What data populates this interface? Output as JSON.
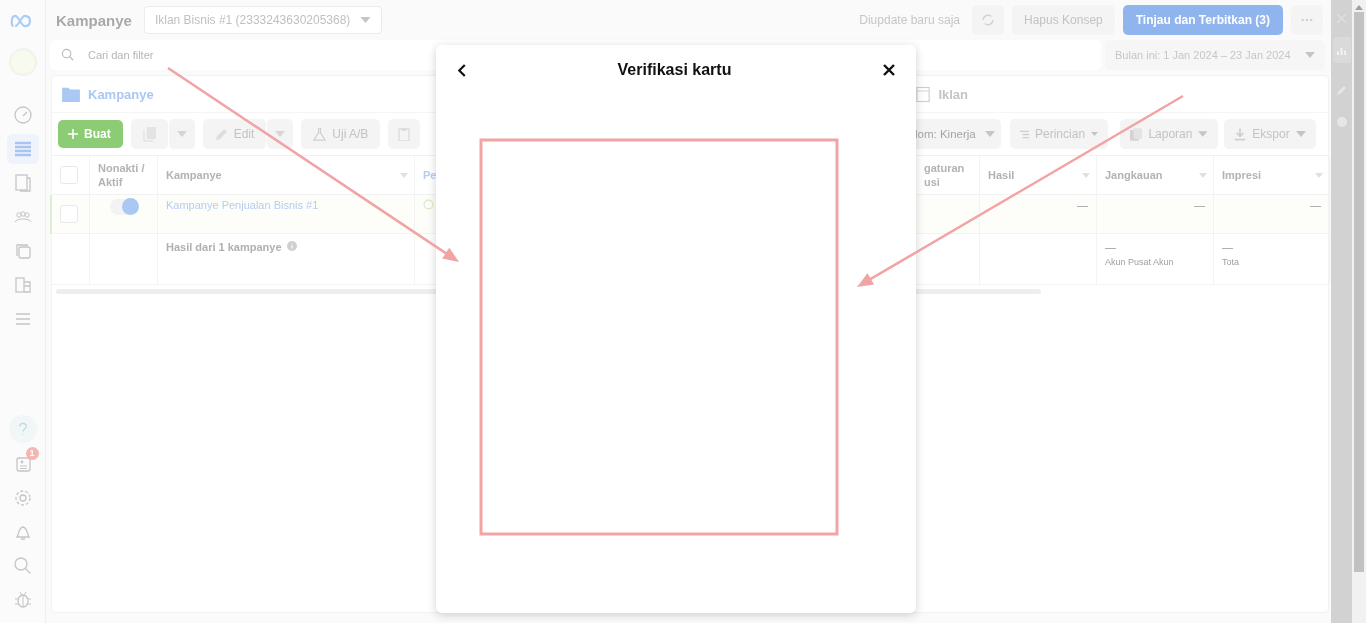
{
  "sidebar": {
    "nav_items": [
      {
        "selected": false
      },
      {
        "selected": true
      },
      {
        "selected": false
      },
      {
        "selected": false
      },
      {
        "selected": false
      },
      {
        "selected": false
      },
      {
        "selected": false
      }
    ],
    "badge": "1"
  },
  "header": {
    "title": "Kampanye",
    "account_select": "Iklan Bisnis #1 (2333243630205368)",
    "status": "Diupdate baru saja",
    "discard_button": "Hapus Konsep",
    "publish_button": "Tinjau dan Terbitkan (3)"
  },
  "search": {
    "placeholder": "Cari dan filter"
  },
  "date_range": "Bulan ini: 1 Jan 2024 – 23 Jan 2024",
  "tabs": [
    {
      "label": "Kampanye",
      "selected": true
    },
    {
      "label": "Iklan",
      "selected": false
    }
  ],
  "toolbar": {
    "create": "Buat",
    "edit": "Edit",
    "ab_test": "Uji A/B",
    "columns": "lom: Kinerja",
    "breakdown": "Perincian",
    "reports": "Laporan",
    "export": "Ekspor"
  },
  "table": {
    "all_selected": false,
    "columns": [
      "Nonakti / Aktif",
      "Kampanye",
      "Pe",
      "gaturan usi",
      "Hasil",
      "Jangkauan",
      "Impresi"
    ],
    "rows": [
      {
        "selected": false,
        "on": true,
        "name": "Kampanye Penjualan Bisnis #1",
        "results": "—",
        "reach": "—",
        "impressions": "—"
      }
    ],
    "summary": {
      "label": "Hasil dari 1 kampanye",
      "reach": "—",
      "reach_note": "Akun Pusat Akun",
      "impressions": "—",
      "impressions_note": "Tota"
    }
  },
  "modal": {
    "title": "Verifikasi kartu"
  }
}
